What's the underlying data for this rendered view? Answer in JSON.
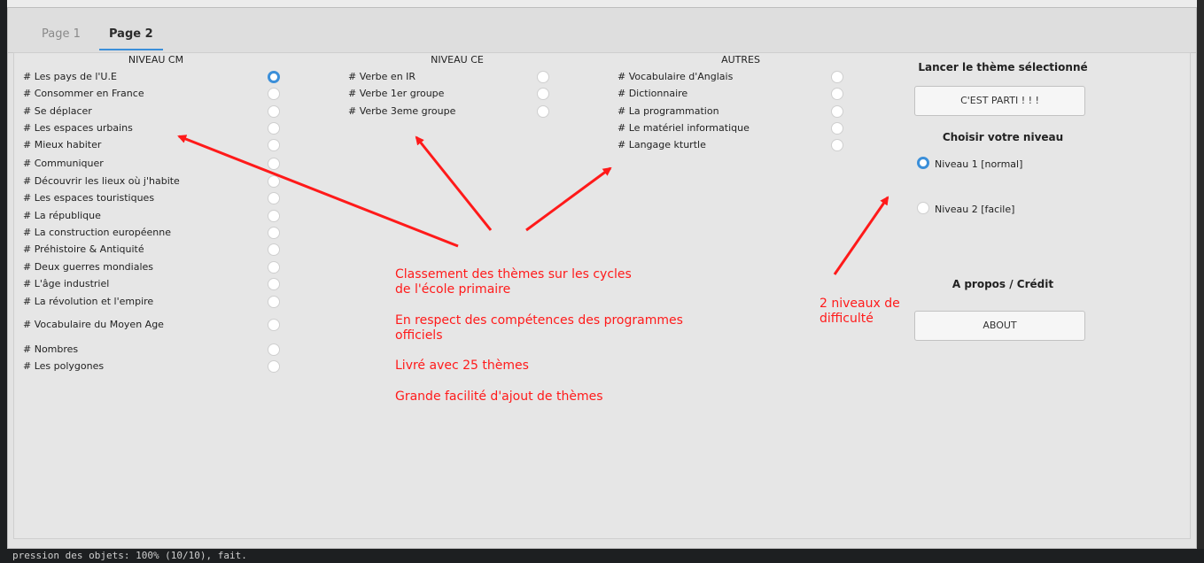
{
  "window": {
    "title": "",
    "tabs": [
      {
        "label": "Page 1",
        "active": false
      },
      {
        "label": "Page 2",
        "active": true
      }
    ]
  },
  "columns": {
    "cm": {
      "header": "NIVEAU CM",
      "items": [
        {
          "label": "# Les pays de l'U.E",
          "checked": true
        },
        {
          "label": "# Consommer en France",
          "checked": false
        },
        {
          "label": "# Se déplacer",
          "checked": false
        },
        {
          "label": "# Les espaces urbains",
          "checked": false
        },
        {
          "label": "# Mieux habiter",
          "checked": false
        },
        {
          "label": "# Communiquer",
          "checked": false
        },
        {
          "label": "# Découvrir les  lieux où j'habite",
          "checked": false
        },
        {
          "label": "# Les espaces touristiques",
          "checked": false
        },
        {
          "label": "# La république",
          "checked": false
        },
        {
          "label": "# La construction européenne",
          "checked": false
        },
        {
          "label": "# Préhistoire & Antiquité",
          "checked": false
        },
        {
          "label": "# Deux guerres mondiales",
          "checked": false
        },
        {
          "label": "# L'âge industriel",
          "checked": false
        },
        {
          "label": "# La révolution et l'empire",
          "checked": false
        },
        {
          "label": "# Vocabulaire du Moyen Age",
          "checked": false
        },
        {
          "label": "# Nombres",
          "checked": false
        },
        {
          "label": "# Les polygones",
          "checked": false
        }
      ]
    },
    "ce": {
      "header": "NIVEAU CE",
      "items": [
        {
          "label": "# Verbe en IR",
          "checked": false
        },
        {
          "label": "# Verbe 1er groupe",
          "checked": false
        },
        {
          "label": "# Verbe 3eme groupe",
          "checked": false
        }
      ]
    },
    "autres": {
      "header": "AUTRES",
      "items": [
        {
          "label": "# Vocabulaire d'Anglais",
          "checked": false
        },
        {
          "label": "# Dictionnaire",
          "checked": false
        },
        {
          "label": "# La programmation",
          "checked": false
        },
        {
          "label": "# Le matériel informatique",
          "checked": false
        },
        {
          "label": "# Langage kturtle",
          "checked": false
        }
      ]
    }
  },
  "right": {
    "launch_title": "Lancer le thème sélectionné",
    "launch_button": "C'EST PARTI ! ! !",
    "level_title": "Choisir votre niveau",
    "levels": [
      {
        "label": "Niveau 1 [normal]",
        "checked": true
      },
      {
        "label": "Niveau 2 [facile]",
        "checked": false
      }
    ],
    "about_title": "A propos / Crédit",
    "about_button": "ABOUT"
  },
  "annotations": {
    "main": [
      "Classement des thèmes sur les cycles",
      "de l'école primaire",
      "En respect des compétences des programmes",
      "officiels",
      "Livré avec 25 thèmes",
      "Grande facilité d'ajout de thèmes"
    ],
    "levels": [
      "2 niveaux de",
      "difficulté"
    ],
    "color": "#ff1a1a"
  },
  "terminal": {
    "bottom_line": "pression des objets: 100% (10/10), fait."
  },
  "colors": {
    "accent": "#3b8fd9",
    "window_bg": "#e3e3e3"
  }
}
